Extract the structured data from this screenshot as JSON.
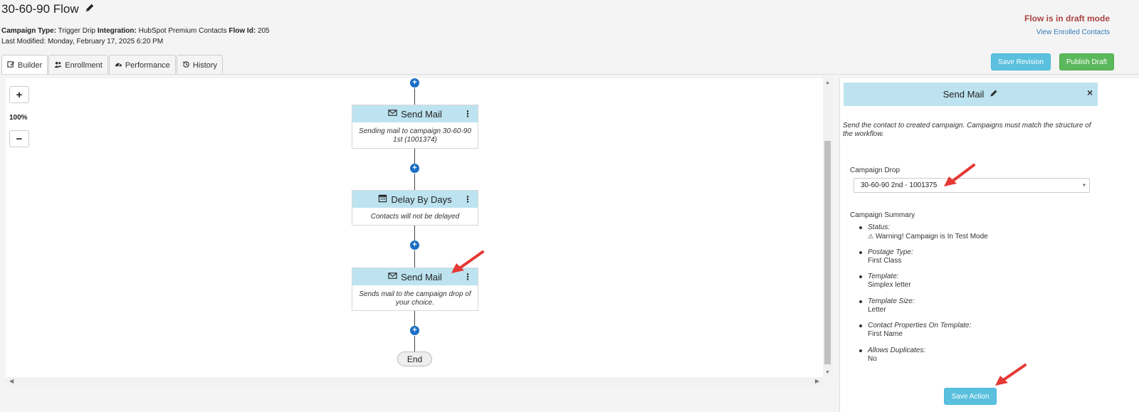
{
  "header": {
    "title": "30-60-90 Flow",
    "campaign_type_label": "Campaign Type:",
    "campaign_type": "Trigger Drip",
    "integration_label": "Integration:",
    "integration": "HubSpot Premium Contacts",
    "flow_id_label": "Flow Id:",
    "flow_id": "205",
    "last_modified_label": "Last Modified:",
    "last_modified": "Monday, February 17, 2025 6:20 PM",
    "draft_status": "Flow is in draft mode",
    "view_enrolled": "View Enrolled Contacts"
  },
  "tabs": [
    {
      "label": "Builder",
      "icon": "edit-icon",
      "active": true
    },
    {
      "label": "Enrollment",
      "icon": "users-icon",
      "active": false
    },
    {
      "label": "Performance",
      "icon": "dashboard-icon",
      "active": false
    },
    {
      "label": "History",
      "icon": "history-icon",
      "active": false
    }
  ],
  "actions": {
    "save_revision": "Save Revision",
    "publish_draft": "Publish Draft"
  },
  "canvas": {
    "zoom_in": "+",
    "zoom_out": "−",
    "zoom_level": "100%",
    "nodes": [
      {
        "title": "Send Mail",
        "icon": "envelope-icon",
        "body": "Sending mail to campaign 30-60-90 1st (1001374)"
      },
      {
        "title": "Delay By Days",
        "icon": "calendar-icon",
        "body": "Contacts will not be delayed"
      },
      {
        "title": "Send Mail",
        "icon": "envelope-icon",
        "body": "Sends mail to the campaign drop of your choice."
      }
    ],
    "end_label": "End"
  },
  "panel": {
    "title": "Send Mail",
    "close": "×",
    "description": "Send the contact to created campaign. Campaigns must match the structure of the workflow.",
    "campaign_drop_label": "Campaign Drop",
    "campaign_drop_value": "30-60-90 2nd - 1001375",
    "summary_label": "Campaign Summary",
    "summary": [
      {
        "key": "Status:",
        "value": "Warning! Campaign is In Test Mode"
      },
      {
        "key": "Postage Type:",
        "value": "First Class"
      },
      {
        "key": "Template:",
        "value": "Simplex letter"
      },
      {
        "key": "Template Size:",
        "value": "Letter"
      },
      {
        "key": "Contact Properties On Template:",
        "value": "First Name"
      },
      {
        "key": "Allows Duplicates:",
        "value": "No"
      }
    ],
    "save_action": "Save Action"
  },
  "colors": {
    "accent_blue": "#5bc0de",
    "accent_green": "#5cb85c",
    "node_header": "#bde3f0",
    "draft_red": "#a94442",
    "link_blue": "#337ab7",
    "arrow_red": "#e53935"
  }
}
